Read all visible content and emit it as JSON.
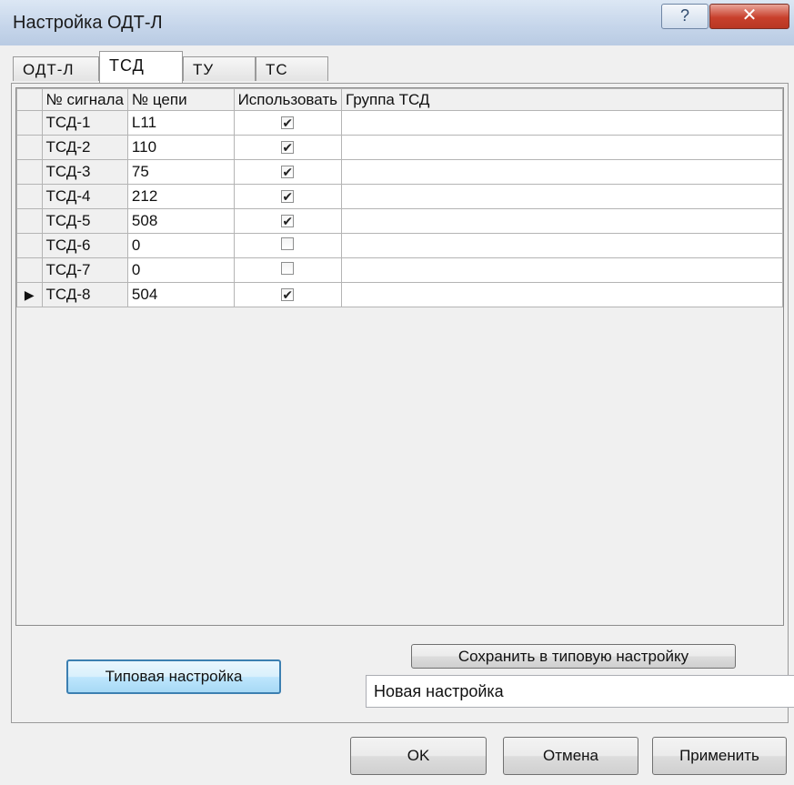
{
  "window": {
    "title": "Настройка ОДТ-Л",
    "help_label": "?",
    "close_label": "✕"
  },
  "tabs": [
    "ОДТ-Л",
    "ТСД",
    "ТУ",
    "ТС"
  ],
  "active_tab": "ТСД",
  "grid": {
    "columns": [
      "№ сигнала",
      "№ цепи",
      "Использовать",
      "Группа ТСД"
    ],
    "current_row_marker": "▶",
    "rows": [
      {
        "signal": "ТСД-1",
        "circuit": "L11",
        "used": true,
        "group": ""
      },
      {
        "signal": "ТСД-2",
        "circuit": "110",
        "used": true,
        "group": ""
      },
      {
        "signal": "ТСД-3",
        "circuit": "75",
        "used": true,
        "group": ""
      },
      {
        "signal": "ТСД-4",
        "circuit": "212",
        "used": true,
        "group": ""
      },
      {
        "signal": "ТСД-5",
        "circuit": "508",
        "used": true,
        "group": ""
      },
      {
        "signal": "ТСД-6",
        "circuit": "0",
        "used": false,
        "group": ""
      },
      {
        "signal": "ТСД-7",
        "circuit": "0",
        "used": false,
        "group": ""
      },
      {
        "signal": "ТСД-8",
        "circuit": "504",
        "used": true,
        "group": ""
      }
    ]
  },
  "preset": {
    "default_button": "Типовая настройка",
    "save_button": "Сохранить в типовую настройку",
    "name_value": "Новая настройка"
  },
  "footer": {
    "ok": "OK",
    "cancel": "Отмена",
    "apply": "Применить"
  }
}
